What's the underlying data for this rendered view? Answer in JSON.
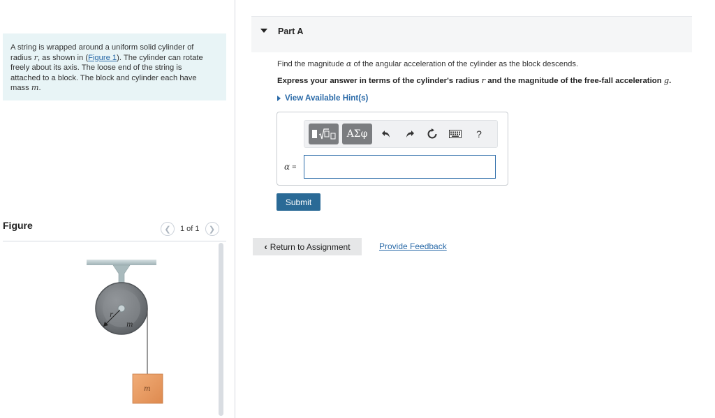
{
  "problem": {
    "line1": "A string is wrapped around a uniform solid cylinder of",
    "line2_a": "radius ",
    "var_r": "r",
    "line2_b": ", as shown in  (",
    "figure_link": "Figure 1",
    "line2_c": "). The cylinder can rotate",
    "line3": "freely about its axis. The loose end of the string is",
    "line4": "attached to a block. The block and cylinder each have",
    "line5_a": "mass ",
    "var_m": "m",
    "line5_b": "."
  },
  "figure": {
    "title": "Figure",
    "page_indicator": "1 of 1",
    "prev_icon": "chevron-left-icon",
    "next_icon": "chevron-right-icon",
    "label_r": "r",
    "label_m_cylinder": "m",
    "label_m_block": "m",
    "colors": {
      "block": "#e8975d",
      "ceiling": "#b9c9cc",
      "cylinder": "#7a7e82",
      "cylinder_dark": "#5d6165"
    }
  },
  "part": {
    "title": "Part A",
    "question_a": "Find the magnitude ",
    "var_alpha": "α",
    "question_b": " of the angular acceleration of the cylinder as the block descends.",
    "express_a": "Express your answer in terms of the cylinder's radius ",
    "express_r": "r",
    "express_b": " and the magnitude of the free-fall acceleration ",
    "express_g": "g",
    "express_c": ".",
    "hint_label": "View Available Hint(s)"
  },
  "answer": {
    "toolbar": {
      "templates_icon": "math-templates-icon",
      "greek_label": "ΑΣφ",
      "undo_icon": "undo-icon",
      "redo_icon": "redo-icon",
      "reset_icon": "reset-icon",
      "keyboard_icon": "keyboard-icon",
      "help_label": "?"
    },
    "label_var": "α",
    "label_eq": "=",
    "input_value": "",
    "submit_label": "Submit"
  },
  "footer": {
    "return_label": "Return to Assignment",
    "feedback_label": "Provide Feedback"
  },
  "colors": {
    "accent": "#2a6aa8",
    "submit": "#2a6a96",
    "problem_bg": "#e8f4f6"
  }
}
